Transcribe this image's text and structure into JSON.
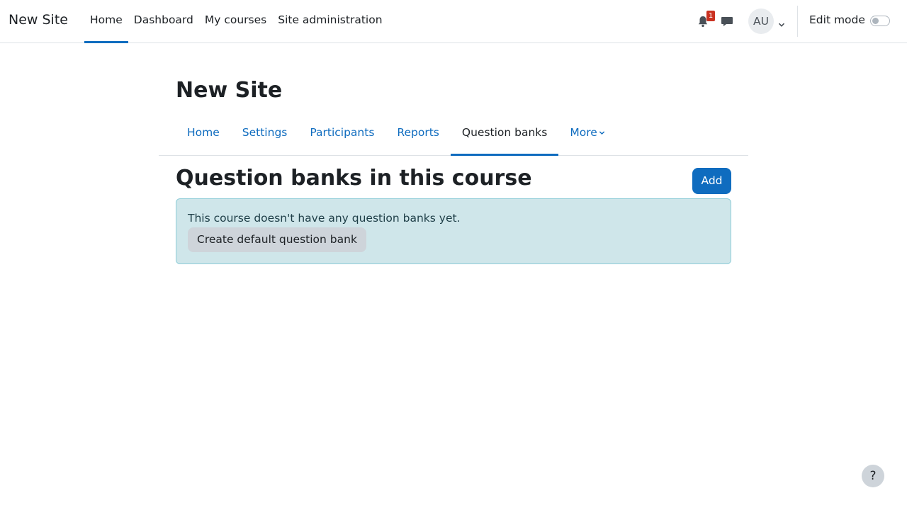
{
  "navbar": {
    "brand": "New Site",
    "items": [
      {
        "label": "Home",
        "active": true
      },
      {
        "label": "Dashboard",
        "active": false
      },
      {
        "label": "My courses",
        "active": false
      },
      {
        "label": "Site administration",
        "active": false
      }
    ],
    "notification_count": "1",
    "user_initials": "AU",
    "edit_mode_label": "Edit mode",
    "edit_mode_on": false
  },
  "page": {
    "title": "New Site"
  },
  "secondary_nav": {
    "tabs": [
      {
        "label": "Home",
        "active": false
      },
      {
        "label": "Settings",
        "active": false
      },
      {
        "label": "Participants",
        "active": false
      },
      {
        "label": "Reports",
        "active": false
      },
      {
        "label": "Question banks",
        "active": true
      }
    ],
    "more_label": "More"
  },
  "main": {
    "heading": "Question banks in this course",
    "add_label": "Add",
    "alert": {
      "message": "This course doesn't have any question banks yet.",
      "button_label": "Create default question bank"
    }
  },
  "help": {
    "label": "?"
  },
  "colors": {
    "primary": "#0f6cbf",
    "badge": "#ca3120",
    "alert_bg": "#cfe6ea",
    "secondary_button": "#ced4da"
  }
}
